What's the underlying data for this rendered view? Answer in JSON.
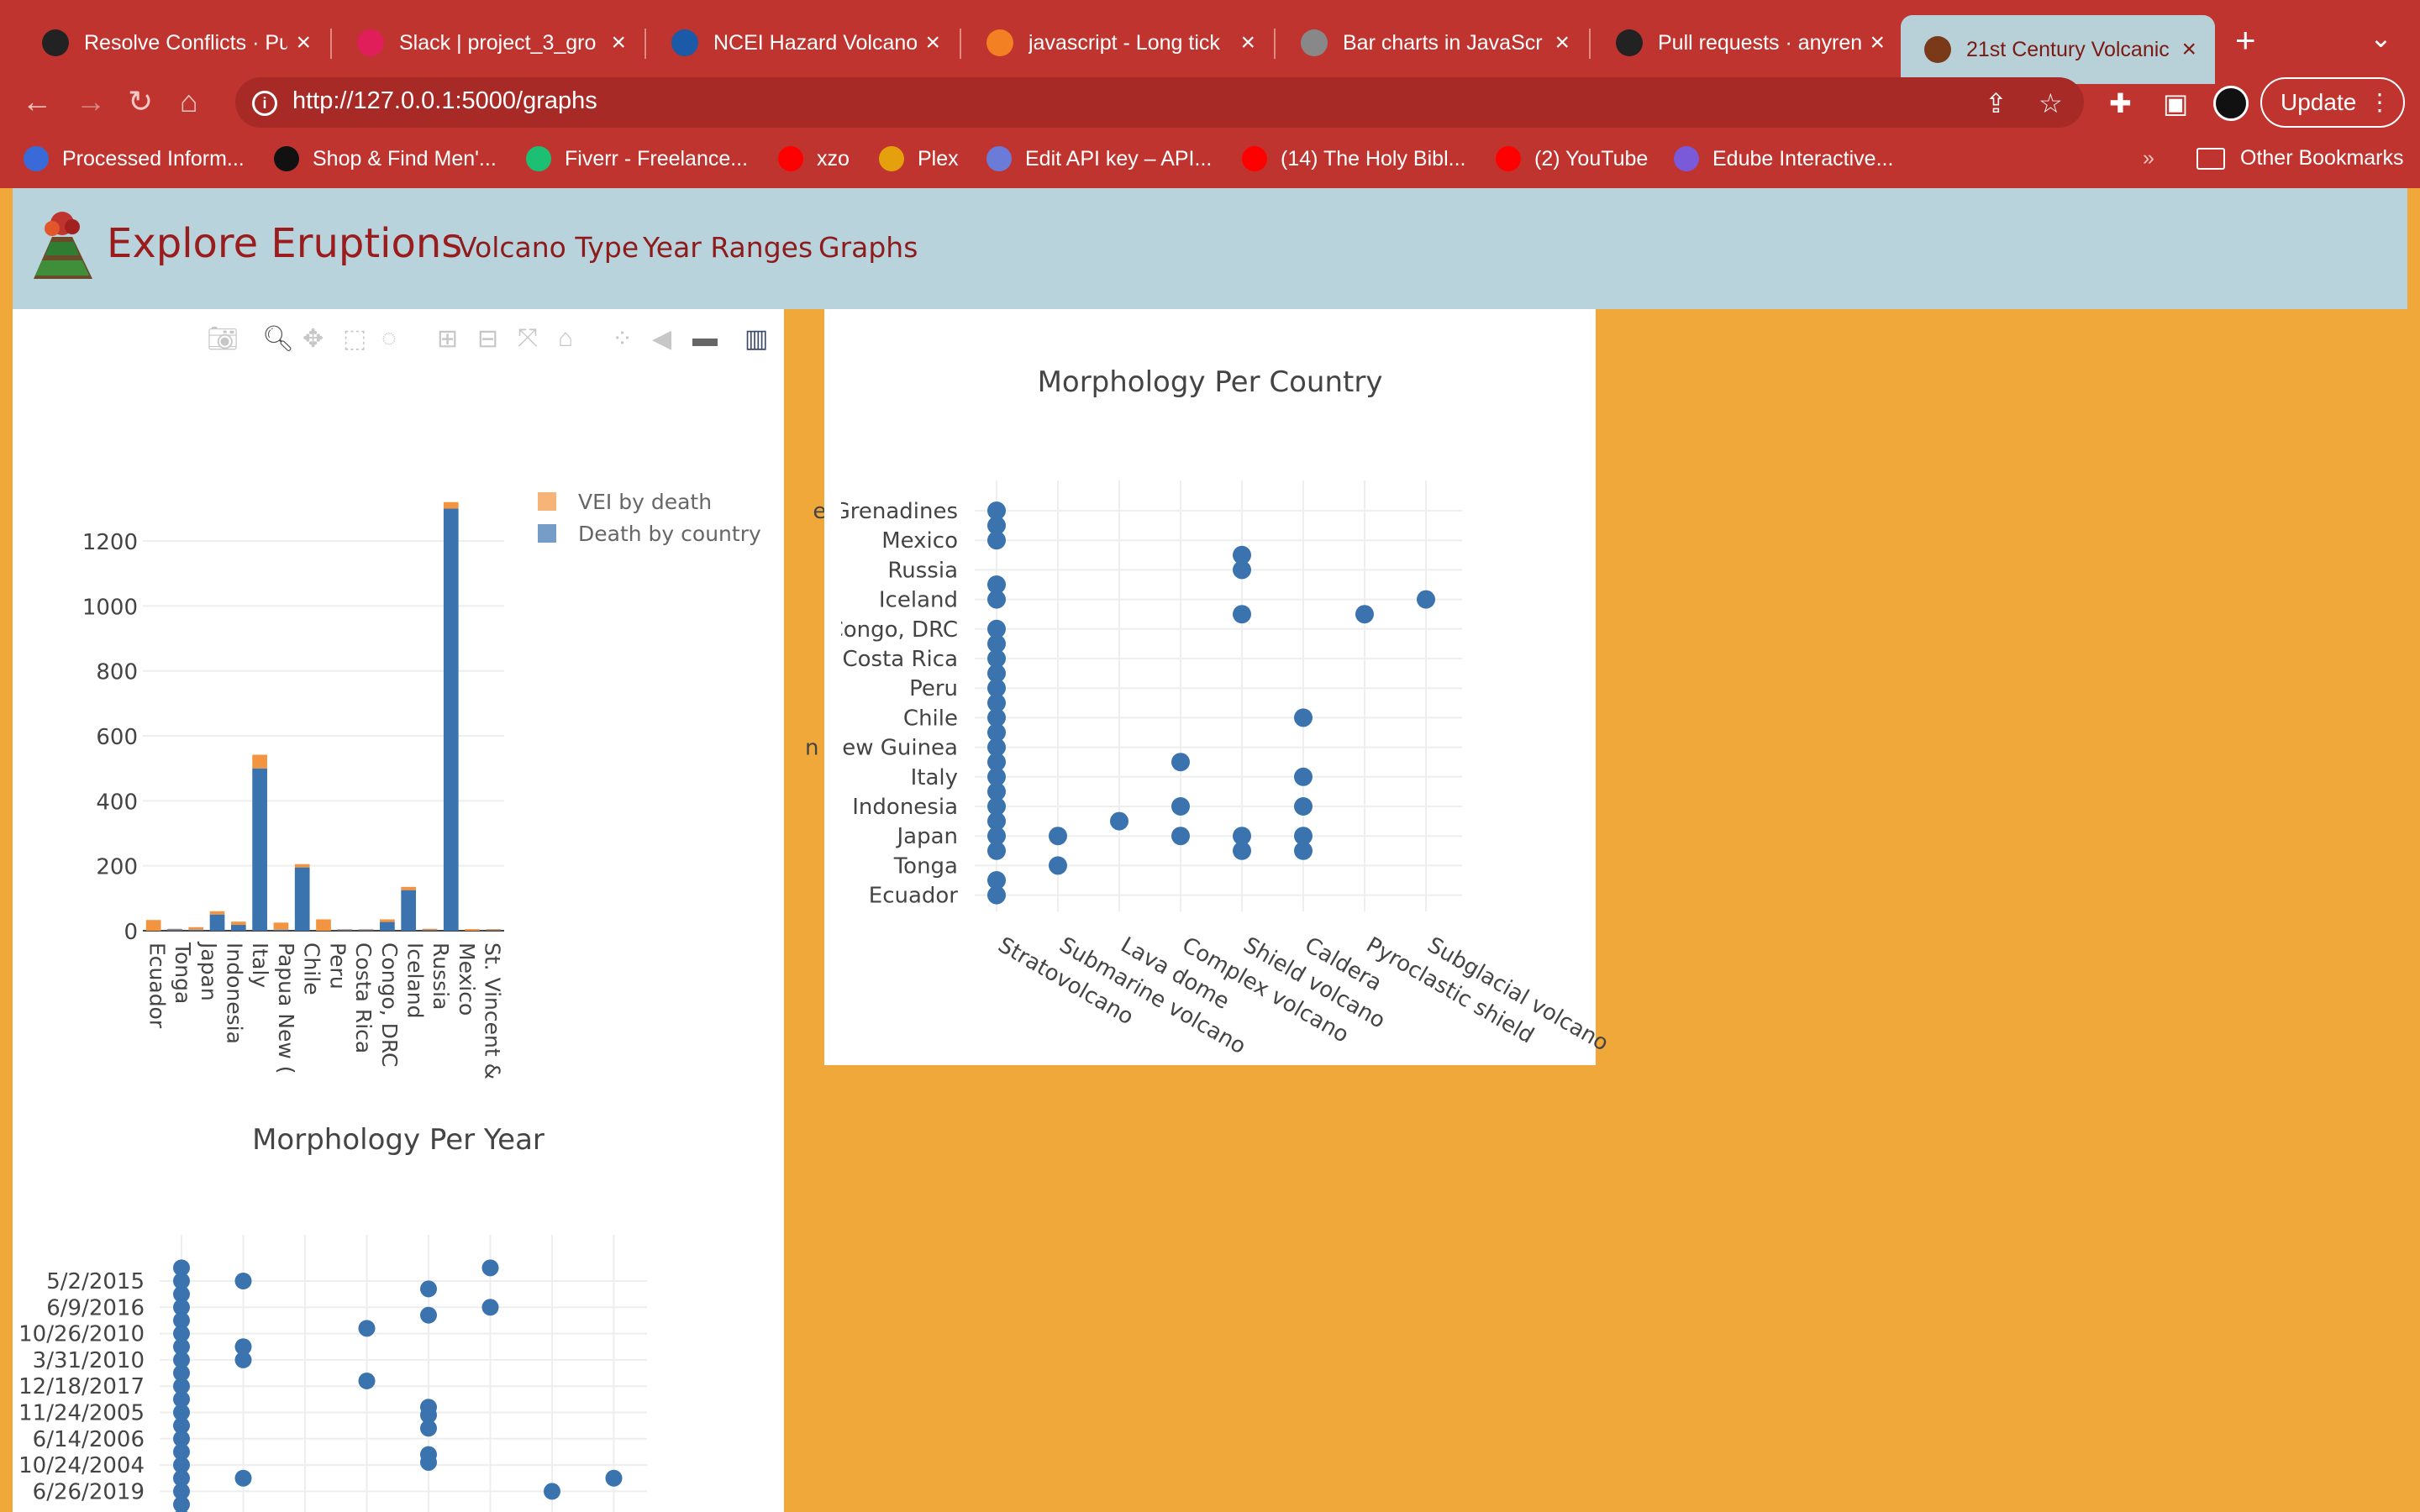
{
  "browser": {
    "tabs": [
      {
        "label": "Resolve Conflicts · Pu",
        "icon": "github-icon",
        "color": "#222222"
      },
      {
        "label": "Slack | project_3_gro",
        "icon": "slack-icon",
        "color": "#e01e5a"
      },
      {
        "label": "NCEI Hazard Volcano",
        "icon": "noaa-icon",
        "color": "#1a5aa6"
      },
      {
        "label": "javascript - Long tick",
        "icon": "stackoverflow-icon",
        "color": "#f48024"
      },
      {
        "label": "Bar charts in JavaScr",
        "icon": "globe-icon",
        "color": "#888888"
      },
      {
        "label": "Pull requests · anyren",
        "icon": "github-icon",
        "color": "#222222"
      },
      {
        "label": "21st Century Volcanic",
        "icon": "volcano-icon",
        "color": "#7a3a1a"
      }
    ],
    "url": "http://127.0.0.1:5000/graphs",
    "update_label": "Update",
    "bookmarks": [
      {
        "label": "Processed Inform...",
        "icon": "globe-icon",
        "color": "#3a6ad8"
      },
      {
        "label": "Shop & Find Men'...",
        "icon": "dj-icon",
        "color": "#111111"
      },
      {
        "label": "Fiverr - Freelance...",
        "icon": "fiverr-icon",
        "color": "#1dbf73"
      },
      {
        "label": "xzo",
        "icon": "youtube-icon",
        "color": "#ff0000"
      },
      {
        "label": "Plex",
        "icon": "plex-icon",
        "color": "#e5a00d"
      },
      {
        "label": "Edit API key – API...",
        "icon": "api-icon",
        "color": "#6a7bd8"
      },
      {
        "label": "(14) The Holy Bibl...",
        "icon": "youtube-icon",
        "color": "#ff0000"
      },
      {
        "label": "(2) YouTube",
        "icon": "youtube-icon",
        "color": "#ff0000"
      },
      {
        "label": "Edube Interactive...",
        "icon": "edube-icon",
        "color": "#7a5ad8"
      }
    ],
    "other_bookmarks": "Other Bookmarks"
  },
  "site": {
    "brand": "Explore Eruptions",
    "nav": [
      "Volcano Type",
      "Year Ranges",
      "Graphs"
    ],
    "accent": "#9b1c1c"
  },
  "chart_data": [
    {
      "type": "bar",
      "title": "",
      "stacked": true,
      "categories": [
        "Ecuador",
        "Tonga",
        "Japan",
        "Indonesia",
        "Italy",
        "Papua New Guinea",
        "Chile",
        "Peru",
        "Costa Rica",
        "Congo, DRC",
        "Iceland",
        "Russia",
        "Mexico",
        "St. Vincent & the Grenadines"
      ],
      "tick_labels": [
        "Ecuador",
        "Tonga",
        "Japan",
        "Indonesia",
        "Italy",
        "Papua New (",
        "Chile",
        "Peru",
        "Costa Rica",
        "Congo, DRC",
        "Iceland",
        "Russia",
        "Mexico",
        "St. Vincent &"
      ],
      "series": [
        {
          "name": "Death by country",
          "color": "#3b73af",
          "values": [
            0,
            4,
            3,
            50,
            18,
            500,
            3,
            195,
            0,
            3,
            3,
            27,
            125,
            2,
            1300,
            0,
            2
          ]
        },
        {
          "name": "VEI by death",
          "color": "#f39440",
          "values": [
            33,
            2,
            8,
            10,
            10,
            42,
            22,
            10,
            35,
            2,
            2,
            8,
            10,
            4,
            20,
            5,
            3
          ]
        }
      ],
      "ylim": [
        0,
        1340
      ],
      "yticks": [
        0,
        200,
        400,
        600,
        800,
        1000,
        1200
      ],
      "legend": "top-right"
    },
    {
      "type": "scatter",
      "title": "Morphology Per Country",
      "x_categories": [
        "Stratovolcano",
        "Submarine volcano",
        "Lava dome",
        "Complex volcano",
        "Shield volcano",
        "Caldera",
        "Pyroclastic shield",
        "Subglacial volcano"
      ],
      "y_tick_labels": [
        "e Grenadines",
        "Mexico",
        "Russia",
        "Iceland",
        "Congo, DRC",
        "Costa Rica",
        "Peru",
        "Chile",
        "n New Guinea",
        "Italy",
        "Indonesia",
        "Japan",
        "Tonga",
        "Ecuador"
      ],
      "points": [
        {
          "x": "Stratovolcano",
          "y": [
            0,
            0.5,
            1,
            2.5,
            3,
            4,
            4.5,
            5,
            5.5,
            6,
            6.5,
            7,
            7.5,
            8,
            8.5,
            9,
            9.5,
            10,
            10.5,
            11,
            11.5,
            12.5,
            13
          ]
        },
        {
          "x": "Submarine volcano",
          "y": [
            11,
            12
          ]
        },
        {
          "x": "Lava dome",
          "y": [
            10.5
          ]
        },
        {
          "x": "Complex volcano",
          "y": [
            8.5,
            10,
            11
          ]
        },
        {
          "x": "Shield volcano",
          "y": [
            1.5,
            2,
            3.5,
            11,
            11.5
          ]
        },
        {
          "x": "Caldera",
          "y": [
            7,
            9,
            10,
            11,
            11.5
          ]
        },
        {
          "x": "Pyroclastic shield",
          "y": [
            3.5
          ]
        },
        {
          "x": "Subglacial volcano",
          "y": [
            3
          ]
        }
      ],
      "marker_color": "#3b73af"
    },
    {
      "type": "scatter",
      "title": "Morphology Per Year",
      "y_tick_labels": [
        "5/2/2015",
        "6/9/2016",
        "10/26/2010",
        "3/31/2010",
        "12/18/2017",
        "11/24/2005",
        "6/14/2006",
        "10/24/2004",
        "6/26/2019"
      ],
      "points": [
        {
          "x": 0,
          "y": [
            -0.5,
            0,
            0.5,
            1,
            1.5,
            2,
            2.5,
            3,
            3.5,
            4,
            4.5,
            5,
            5.5,
            6,
            6.5,
            7,
            7.5,
            8,
            8.5,
            9
          ]
        },
        {
          "x": 1,
          "y": [
            0,
            2.5,
            3,
            7.5
          ]
        },
        {
          "x": 3,
          "y": [
            1.8,
            3.8
          ]
        },
        {
          "x": 4,
          "y": [
            0.3,
            1.3,
            4.8,
            5.1,
            5.6,
            6.6,
            6.9
          ]
        },
        {
          "x": 5,
          "y": [
            -0.5,
            1
          ]
        },
        {
          "x": 6,
          "y": [
            8
          ]
        },
        {
          "x": 7,
          "y": [
            7.5
          ]
        }
      ],
      "marker_color": "#3b73af"
    }
  ]
}
